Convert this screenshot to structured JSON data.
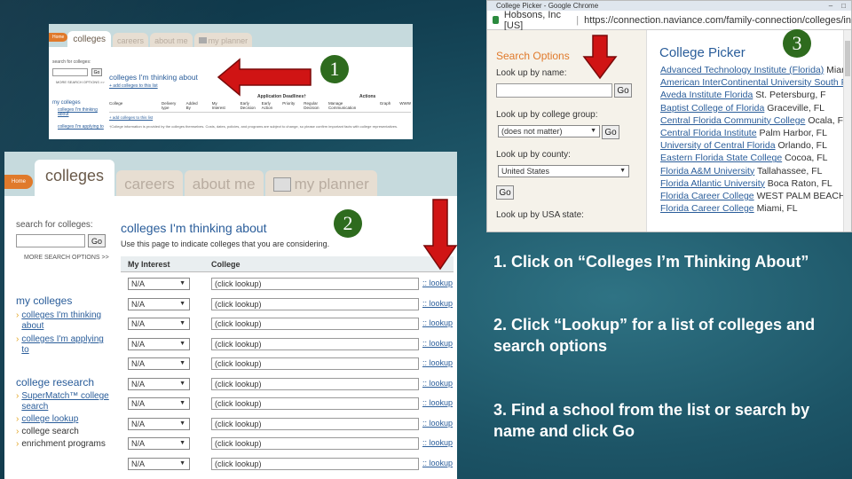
{
  "markers": [
    "1",
    "2",
    "3"
  ],
  "instructions": [
    "1. Click on “Colleges I’m Thinking About”",
    "2. Click “Lookup” for a list of colleges and search options",
    "3. Find a school from the list or search by name and click Go"
  ],
  "s1": {
    "home": "Home",
    "tabs": [
      "colleges",
      "careers",
      "about me",
      "my planner"
    ],
    "search_label": "search for colleges:",
    "go": "Go",
    "more": "MORE SEARCH OPTIONS >>",
    "my_colleges": "my colleges",
    "nav": [
      "colleges I'm thinking about",
      "colleges I'm applying to"
    ],
    "title": "colleges I'm thinking about",
    "add_link": "+ add colleges to this list",
    "app_deadlines": "Application Deadlines†",
    "actions": "Actions",
    "cols": [
      "College",
      "Delivery type",
      "Added By",
      "My Interest",
      "Early Decision",
      "Early Action",
      "Priority",
      "Regular Decision",
      "Manage Communication",
      "Graph",
      "WWW"
    ],
    "disclaimer": "†College information is provided by the colleges themselves. Costs, dates, policies, and programs are subject to change, so please confirm important facts with college representatives."
  },
  "s2": {
    "research_heading": "college research",
    "research": [
      "SuperMatch™ college search",
      "college lookup",
      "college search",
      "enrichment programs"
    ],
    "description": "Use this page to indicate colleges that you are considering.",
    "cols": [
      "My Interest",
      "College"
    ],
    "rows": [
      {
        "interest": "N/A",
        "college": "(click lookup)",
        "action": ":: lookup"
      },
      {
        "interest": "N/A",
        "college": "(click lookup)",
        "action": ":: lookup"
      },
      {
        "interest": "N/A",
        "college": "(click lookup)",
        "action": ":: lookup"
      },
      {
        "interest": "N/A",
        "college": "(click lookup)",
        "action": ":: lookup"
      },
      {
        "interest": "N/A",
        "college": "(click lookup)",
        "action": ":: lookup"
      },
      {
        "interest": "N/A",
        "college": "(click lookup)",
        "action": ":: lookup"
      },
      {
        "interest": "N/A",
        "college": "(click lookup)",
        "action": ":: lookup"
      },
      {
        "interest": "N/A",
        "college": "(click lookup)",
        "action": ":: lookup"
      },
      {
        "interest": "N/A",
        "college": "(click lookup)",
        "action": ":: lookup"
      },
      {
        "interest": "N/A",
        "college": "(click lookup)",
        "action": ":: lookup"
      }
    ]
  },
  "s3": {
    "window_title": "College Picker - Google Chrome",
    "site": "Hobsons, Inc [US]",
    "url": "https://connection.naviance.com/family-connection/colleges/in",
    "search_heading": "Search Options",
    "by_name": "Look up by name:",
    "go": "Go",
    "by_group": "Look up by college group:",
    "group_value": "(does not matter)",
    "by_county": "Look up by county:",
    "county_value": "United States",
    "by_state": "Look up by USA state:",
    "picker_title": "College Picker",
    "colleges": [
      {
        "name": "Advanced Technology Institute (Florida)",
        "loc": "Miami, FL"
      },
      {
        "name": "American InterContinental University South Florida",
        "loc": ""
      },
      {
        "name": "Aveda Institute Florida",
        "loc": "St. Petersburg, F"
      },
      {
        "name": "Baptist College of Florida",
        "loc": "Graceville, FL"
      },
      {
        "name": "Central Florida Community College",
        "loc": "Ocala, FL"
      },
      {
        "name": "Central Florida Institute",
        "loc": "Palm Harbor, FL"
      },
      {
        "name": "University of Central Florida",
        "loc": "Orlando, FL"
      },
      {
        "name": "Eastern Florida State College",
        "loc": "Cocoa, FL"
      },
      {
        "name": "Florida A&M University",
        "loc": "Tallahassee, FL"
      },
      {
        "name": "Florida Atlantic University",
        "loc": "Boca Raton, FL"
      },
      {
        "name": "Florida Career College",
        "loc": "WEST PALM BEACH, Flor"
      },
      {
        "name": "Florida Career College",
        "loc": "Miami, FL"
      }
    ]
  }
}
